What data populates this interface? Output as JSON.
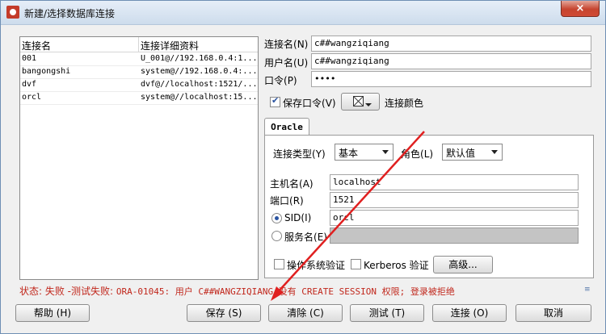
{
  "window": {
    "title": "新建/选择数据库连接",
    "close_label": "×"
  },
  "connections": {
    "headers": [
      "连接名",
      "连接详细资料"
    ],
    "rows": [
      {
        "name": "001",
        "details": "U_001@//192.168.0.4:1..."
      },
      {
        "name": "bangongshi",
        "details": "system@//192.168.0.4:..."
      },
      {
        "name": "dvf",
        "details": "dvf@//localhost:1521/..."
      },
      {
        "name": "orcl",
        "details": "system@//localhost:15..."
      }
    ]
  },
  "form": {
    "conn_name_label": "连接名",
    "conn_name_key": "(N)",
    "conn_name_value": "c##wangziqiang",
    "username_label": "用户名",
    "username_key": "(U)",
    "username_value": "c##wangziqiang",
    "password_label": "口令",
    "password_key": "(P)",
    "password_value": "••••",
    "save_password_label": "保存口令",
    "save_password_key": "(V)",
    "save_password_checked": true,
    "conn_color_label": "连接颜色"
  },
  "tab": {
    "label": "Oracle",
    "conn_type_label": "连接类型",
    "conn_type_key": "(Y)",
    "conn_type_value": "基本",
    "role_label": "角色",
    "role_key": "(L)",
    "role_value": "默认值",
    "host_label": "主机名",
    "host_key": "(A)",
    "host_value": "localhost",
    "port_label": "端口",
    "port_key": "(R)",
    "port_value": "1521",
    "sid_label": "SID",
    "sid_key": "(I)",
    "sid_value": "orcl",
    "service_label": "服务名",
    "service_key": "(E)",
    "os_auth_label": "操作系统验证",
    "kerberos_label": "Kerberos 验证",
    "advanced_label": "高级..."
  },
  "status": {
    "prefix": "状态: 失败 -测试失败: ",
    "message_mono": "ORA-01045: 用户 C##WANGZIQIANG 没有 CREATE SESSION 权限; 登录被拒绝",
    "icon": "≡"
  },
  "buttons": {
    "help": "帮助 (H)",
    "save": "保存 (S)",
    "clear": "清除 (C)",
    "test": "测试 (T)",
    "connect": "连接 (O)",
    "cancel": "取消"
  },
  "colors": {
    "status_error": "#c1271c",
    "annotation_arrow": "#e02020"
  }
}
